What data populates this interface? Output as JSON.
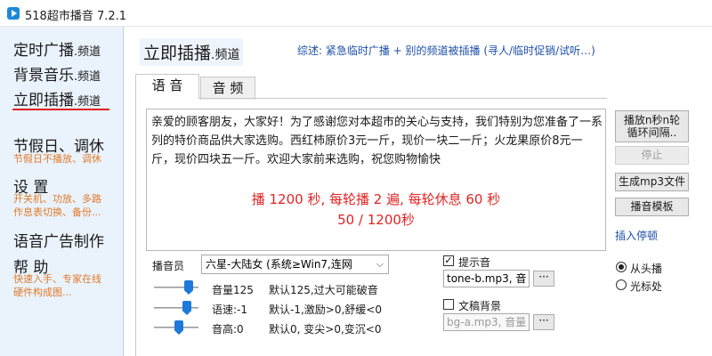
{
  "window": {
    "title": "518超市播音 7.2.1"
  },
  "sidebar": {
    "items": [
      {
        "label": "定时广播",
        "suffix": ".频道"
      },
      {
        "label": "背景音乐",
        "suffix": ".频道"
      },
      {
        "label": "立即插播",
        "suffix": ".频道"
      }
    ],
    "holiday": {
      "label": "节假日、调休",
      "desc": "节假日不播放、调休"
    },
    "settings": {
      "label": "设 置",
      "desc1": "开关机、功放、多路",
      "desc2": "作息表切换、备份..."
    },
    "ad": {
      "label": "语音广告制作"
    },
    "help": {
      "label": "帮 助",
      "desc1": "快速入手、专家在线",
      "desc2": "硬件构成图..."
    }
  },
  "main": {
    "title": "立即插播",
    "title_suffix": ".频道",
    "summary": "综述: 紧急临时广播 + 别的频道被插播  (寻人/临时促销/试听…)",
    "tabs": [
      "语 音",
      "音 频"
    ],
    "message": "亲爱的顾客朋友，大家好！为了感谢您对本超市的关心与支持，我们特别为您准备了一系列的特价商品供大家选购。西红柿原价3元一斤，现价一块二一斤；火龙果原价8元一斤，现价四块五一斤。欢迎大家前来选购，祝您购物愉快",
    "stats_line1": "播 1200 秒, 每轮播 2 遍, 每轮休息 60 秒",
    "stats_line2": "50 / 1200秒"
  },
  "buttons": {
    "loop": "播放n秒n轮\n循环间隔..",
    "stop": "停止",
    "mp3": "生成mp3文件",
    "template": "播音模板",
    "insert_pause": "插入停顿"
  },
  "voice": {
    "announcer_label": "播音员",
    "announcer_value": "六星-大陆女 (系统≥Win7,连网",
    "volume_label": "音量125",
    "volume_hint": "默认125,过大可能破音",
    "speed_label": "语速:-1",
    "speed_hint": "默认-1,激励>0,舒缓<0",
    "pitch_label": "音高:0",
    "pitch_hint": "默认0, 变尖>0,变沉<0",
    "volume_level": 125,
    "speed_level": -1,
    "pitch_level": 0
  },
  "options": {
    "prompt_label": "提示音",
    "prompt_checked": true,
    "prompt_file": "tone-b.mp3, 音",
    "bg_label": "文稿背景",
    "bg_checked": false,
    "bg_file": "bg-a.mp3, 音量",
    "browse": "···",
    "radio_start": "从头播",
    "radio_cursor": "光标处"
  }
}
